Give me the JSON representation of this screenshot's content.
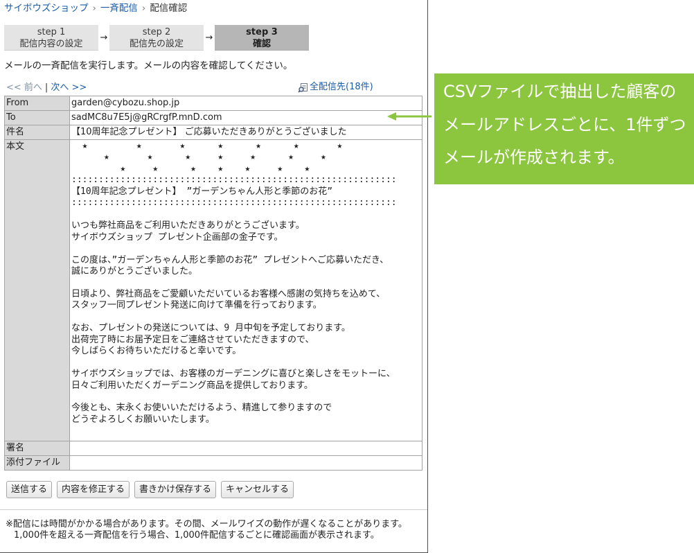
{
  "breadcrumb": {
    "items": [
      {
        "label": "サイボウズショップ"
      },
      {
        "label": "一斉配信"
      },
      {
        "label": "配信確認"
      }
    ],
    "separator": "›"
  },
  "steps": [
    {
      "step": "step 1",
      "label": "配信内容の設定",
      "active": false
    },
    {
      "step": "step 2",
      "label": "配信先の設定",
      "active": false
    },
    {
      "step": "step 3",
      "label": "確認",
      "active": true
    }
  ],
  "step_arrow": "→",
  "instruction": "メールの一斉配信を実行します。メールの内容を確認してください。",
  "pager": {
    "prev": "<< 前へ",
    "separator": "|",
    "next": "次へ >>"
  },
  "all_recipients": {
    "icon": "recipient-list-icon",
    "label": "全配信先(18件)"
  },
  "mail": {
    "from": {
      "label": "From",
      "value": "garden@cybozu.shop.jp"
    },
    "to": {
      "label": "To",
      "value": "sadMC8u7E5j@gRCrgfP.mnD.com"
    },
    "subject": {
      "label": "件名",
      "value": "【10周年記念プレゼント】 ご応募いただきありがとうございました"
    },
    "body": {
      "label": "本文",
      "value": "  ★         ★       ★      ★      ★      ★       ★\n      ★       ★      ★     ★     ★      ★     ★\n         ★     ★      ★    ★    ★     ★    ★\n::::::::::::::::::::::::::::::::::::::::::::::::::::::::::::\n【10周年記念プレゼント】 ”ガーデンちゃん人形と季節のお花”\n::::::::::::::::::::::::::::::::::::::::::::::::::::::::::::\n\nいつも弊社商品をご利用いただきありがとうございます。\nサイボウズショップ プレゼント企画部の金子です。\n\nこの度は、”ガーデンちゃん人形と季節のお花” プレゼントへご応募いただき、\n誠にありがとうございました。\n\n日頃より、弊社商品をご愛顧いただいているお客様へ感謝の気持ちを込めて、\nスタッフ一同プレゼント発送に向けて準備を行っております。\n\nなお、プレゼントの発送については、9 月中旬を予定しております。\n出荷完了時にお届予定日をご連絡させていただきますので、\n今しばらくお待ちいただけると幸いです。\n\nサイボウズショップでは、お客様のガーデニングに喜びと楽しさをモットーに、\n日々ご利用いただくガーデニング商品を提供しております。\n\n今後とも、末永くお使いいただけるよう、精進して参りますので\nどうぞよろしくお願いいたします。"
    },
    "signature": {
      "label": "署名"
    },
    "attachments": {
      "label": "添付ファイル"
    }
  },
  "buttons": {
    "send": "送信する",
    "edit": "内容を修正する",
    "save_draft": "書きかけ保存する",
    "cancel": "キャンセルする"
  },
  "notes": [
    "※配信には時間がかかる場合があります。その間、メールワイズの動作が遅くなることがあります。",
    "1,000件を超える一斉配信を行う場合、1,000件配信するごとに確認画面が表示されます。"
  ],
  "callout": {
    "lines": [
      "CSVファイルで抽出した顧客の",
      "メールアドレスごとに、1件ずつ",
      "メールが作成されます。"
    ],
    "arrow_icon": "arrow-left-icon"
  },
  "colors": {
    "link": "#1a5ba6",
    "accent_green": "#8cc63f",
    "label_bg": "#d9d9d9",
    "step_bg": "#e4e4e4",
    "active_step_bg": "#b6b6b6"
  }
}
